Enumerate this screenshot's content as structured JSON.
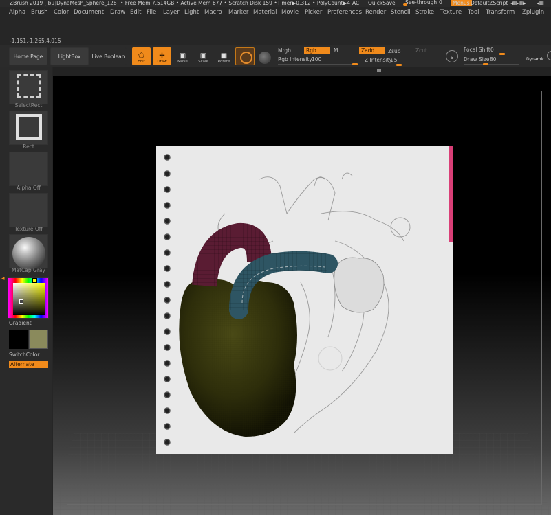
{
  "titlebar": {
    "app_title": "ZBrush 2019 [ibu]DynaMesh_Sphere_128",
    "free_mem": "• Free Mem 7.514GB • Active Mem 677 • Scratch Disk 159 •",
    "timer": "Timer▶0.312 • PolyCount▶4",
    "ac": "AC",
    "quicksave": "QuickSave",
    "see_through": "See-through",
    "see_through_value": "0",
    "menus": "Menus",
    "zscript": "DefaultZScript"
  },
  "menubar": {
    "items": [
      "Alpha",
      "Brush",
      "Color",
      "Document",
      "Draw",
      "Edit",
      "File",
      "Layer",
      "Light",
      "Macro",
      "Marker",
      "Material",
      "Movie",
      "Picker",
      "Preferences",
      "Render",
      "Stencil",
      "Stroke",
      "Texture",
      "Tool",
      "Transform",
      "Zplugin"
    ]
  },
  "coords": "-1.151,-1.265,4.015",
  "shelf": {
    "home_page": "Home Page",
    "lightbox": "LightBox",
    "live_boolean": "Live Boolean",
    "edit": "Edit",
    "draw": "Draw",
    "move": "Move",
    "scale": "Scale",
    "rotate": "Rotate",
    "mrgb": "Mrgb",
    "rgb": "Rgb",
    "m": "M",
    "zadd": "Zadd",
    "zsub": "Zsub",
    "zcut": "Zcut",
    "rgb_intensity_label": "Rgb Intensity",
    "rgb_intensity_value": "100",
    "z_intensity_label": "Z Intensity",
    "z_intensity_value": "25",
    "focal_shift_label": "Focal Shift",
    "focal_shift_value": "0",
    "draw_size_label": "Draw Size",
    "draw_size_value": "80",
    "dynamic": "Dynamic",
    "s_label": "S"
  },
  "left_panel": {
    "select_rect": "SelectRect",
    "rect": "Rect",
    "alpha_off": "Alpha Off",
    "texture_off": "Texture Off",
    "matcap_gray": "MatCap Gray",
    "gradient": "Gradient",
    "switch_color": "SwitchColor",
    "alternate": "Alternate"
  },
  "colors": {
    "accent": "#f08a1b",
    "heart_body": "#3a3a10",
    "aorta_red": "#5a1c33",
    "artery_blue": "#2e5563"
  }
}
